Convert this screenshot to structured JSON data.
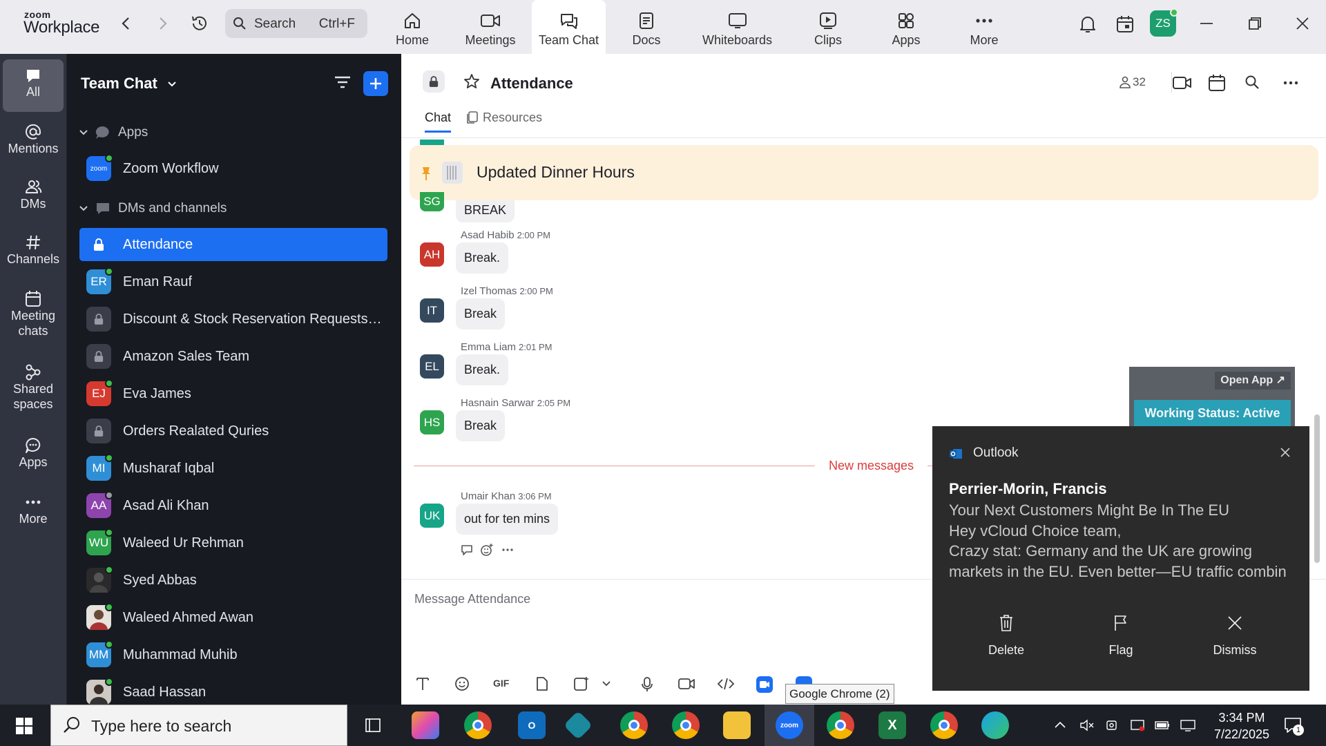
{
  "app": {
    "brand_top": "zoom",
    "brand_bottom": "Workplace"
  },
  "search": {
    "placeholder": "Search",
    "shortcut": "Ctrl+F"
  },
  "nav_tabs": [
    {
      "label": "Home",
      "icon": "home-icon"
    },
    {
      "label": "Meetings",
      "icon": "video-icon"
    },
    {
      "label": "Team Chat",
      "icon": "chat-icon",
      "active": true
    },
    {
      "label": "Docs",
      "icon": "doc-icon"
    },
    {
      "label": "Whiteboards",
      "icon": "whiteboard-icon"
    },
    {
      "label": "Clips",
      "icon": "clips-icon"
    },
    {
      "label": "Apps",
      "icon": "apps-icon"
    },
    {
      "label": "More",
      "icon": "more-icon"
    }
  ],
  "user_avatar": "ZS",
  "rail": [
    {
      "label": "All",
      "icon": "chat-bubble-icon",
      "active": true
    },
    {
      "label": "Mentions",
      "icon": "at-icon"
    },
    {
      "label": "DMs",
      "icon": "people-icon"
    },
    {
      "label": "Channels",
      "icon": "hash-icon"
    },
    {
      "label": "Meeting chats",
      "icon": "calendar-icon"
    },
    {
      "label": "Shared spaces",
      "icon": "shared-icon"
    },
    {
      "label": "Apps",
      "icon": "apps-bubble-icon"
    },
    {
      "label": "More",
      "icon": "ellipsis-icon"
    }
  ],
  "sidebar": {
    "title": "Team Chat",
    "sections": {
      "apps": "Apps",
      "dms": "DMs and channels"
    },
    "app_item": "Zoom Workflow",
    "app_item_badge": "zoom",
    "items": [
      {
        "label": "Attendance",
        "type": "lock",
        "selected": true
      },
      {
        "label": "Eman Rauf",
        "initials": "ER",
        "color": "#2f8fd6",
        "status": "online"
      },
      {
        "label": "Discount & Stock Reservation Requests O...",
        "type": "lock"
      },
      {
        "label": "Amazon Sales Team",
        "type": "lock"
      },
      {
        "label": "Eva James",
        "initials": "EJ",
        "color": "#d63a2f",
        "status": "online"
      },
      {
        "label": "Orders Realated Quries",
        "type": "lock"
      },
      {
        "label": "Musharaf Iqbal",
        "initials": "MI",
        "color": "#2f8fd6",
        "status": "online"
      },
      {
        "label": "Asad Ali Khan",
        "initials": "AA",
        "color": "#8e44ad",
        "status": "away"
      },
      {
        "label": "Waleed Ur Rehman",
        "initials": "WU",
        "color": "#2ea44f",
        "status": "online"
      },
      {
        "label": "Syed Abbas",
        "type": "photo",
        "status": "online"
      },
      {
        "label": "Waleed Ahmed Awan",
        "type": "photo",
        "status": "online"
      },
      {
        "label": "Muhammad Muhib",
        "initials": "MM",
        "color": "#2f8fd6",
        "status": "online"
      },
      {
        "label": "Saad Hassan",
        "type": "photo",
        "status": "online"
      }
    ]
  },
  "channel": {
    "title": "Attendance",
    "member_count": "32",
    "tabs": {
      "chat": "Chat",
      "resources": "Resources"
    },
    "pinned": "Updated Dinner Hours",
    "partial_top": {
      "initials": "SG",
      "text": "BREAK"
    },
    "messages": [
      {
        "name": "Asad Habib",
        "time": "2:00 PM",
        "initials": "AH",
        "color": "#c9372c",
        "text": "Break."
      },
      {
        "name": "Izel Thomas",
        "time": "2:00 PM",
        "initials": "IT",
        "color": "#34495e",
        "text": "Break"
      },
      {
        "name": "Emma Liam",
        "time": "2:01 PM",
        "initials": "EL",
        "color": "#34495e",
        "text": "Break."
      },
      {
        "name": "Hasnain Sarwar",
        "time": "2:05 PM",
        "initials": "HS",
        "color": "#2ea44f",
        "text": "Break"
      },
      {
        "name": "Umair Khan",
        "time": "3:06 PM",
        "initials": "UK",
        "color": "#17a589",
        "text": "out for ten mins"
      }
    ],
    "new_messages": "New messages",
    "compose_placeholder": "Message Attendance"
  },
  "working_status": {
    "open_app": "Open App ↗",
    "status": "Working Status: Active"
  },
  "toast": {
    "app": "Outlook",
    "sender": "Perrier-Morin, Francis",
    "lines": [
      "Your Next Customers Might Be In The EU",
      "Hey vCloud Choice team,",
      "Crazy stat: Germany and the UK are growing",
      "markets in the EU.  Even better—EU traffic combin"
    ],
    "actions": [
      "Delete",
      "Flag",
      "Dismiss"
    ]
  },
  "tooltip": "Google Chrome (2)",
  "taskbar": {
    "search_placeholder": "Type here to search",
    "time": "3:34 PM",
    "date": "7/22/2025",
    "notifications": "1"
  }
}
